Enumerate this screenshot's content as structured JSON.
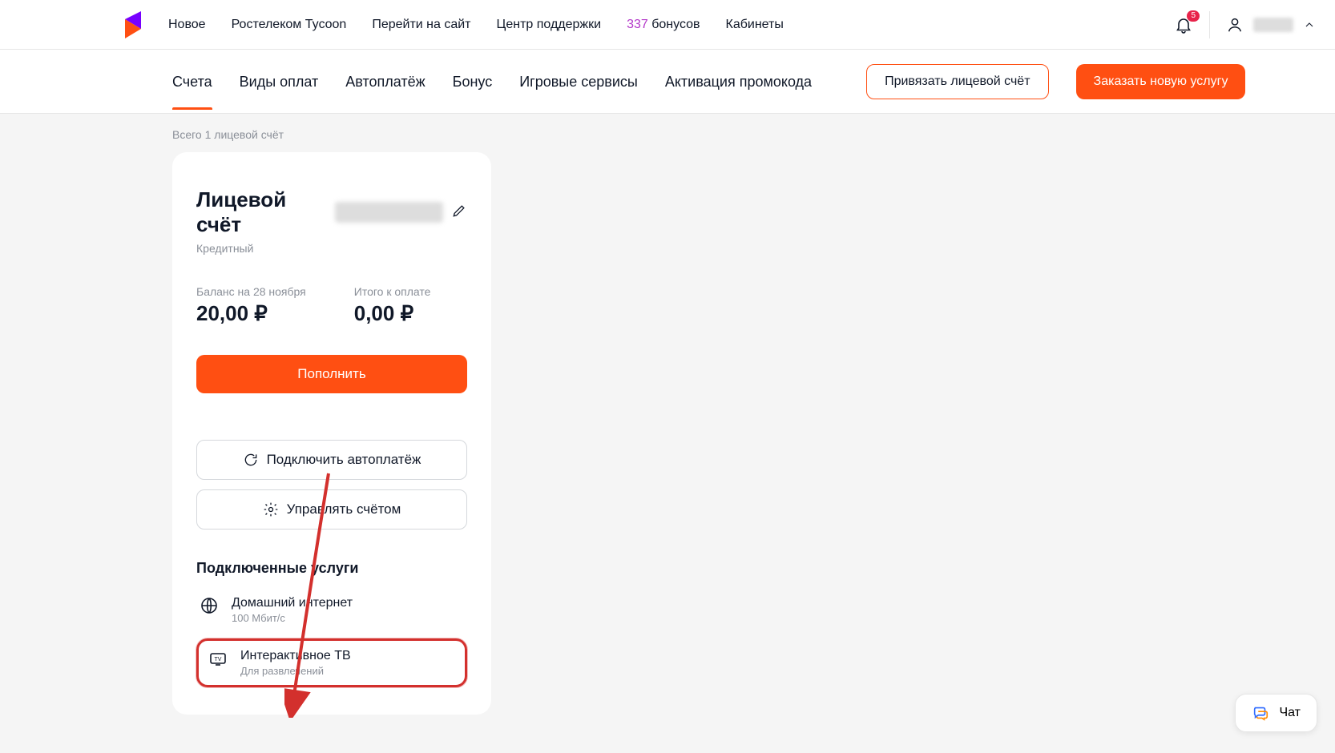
{
  "header": {
    "nav": [
      {
        "label": "Новое"
      },
      {
        "label": "Ростелеком Tycoon"
      },
      {
        "label": "Перейти на сайт"
      },
      {
        "label": "Центр поддержки"
      }
    ],
    "bonus_count": "337",
    "bonus_word": "бонусов",
    "cabinets": "Кабинеты",
    "notif_badge": "5"
  },
  "tabs": [
    {
      "label": "Счета",
      "active": true
    },
    {
      "label": "Виды оплат"
    },
    {
      "label": "Автоплатёж"
    },
    {
      "label": "Бонус"
    },
    {
      "label": "Игровые сервисы"
    },
    {
      "label": "Активация промокода"
    }
  ],
  "actions": {
    "link_account": "Привязать лицевой счёт",
    "order_service": "Заказать новую услугу"
  },
  "accounts_total": "Всего 1 лицевой счёт",
  "card": {
    "title": "Лицевой счёт",
    "type": "Кредитный",
    "balance_label": "Баланс на 28 ноября",
    "balance_value": "20,00 ₽",
    "due_label": "Итого к оплате",
    "due_value": "0,00 ₽",
    "topup": "Пополнить",
    "autopay": "Подключить автоплатёж",
    "manage": "Управлять счётом",
    "services_title": "Подключенные услуги",
    "svc1_name": "Домашний интернет",
    "svc1_sub": "100 Мбит/c",
    "svc2_name": "Интерактивное ТВ",
    "svc2_sub": "Для развлечений"
  },
  "chat_label": "Чат"
}
